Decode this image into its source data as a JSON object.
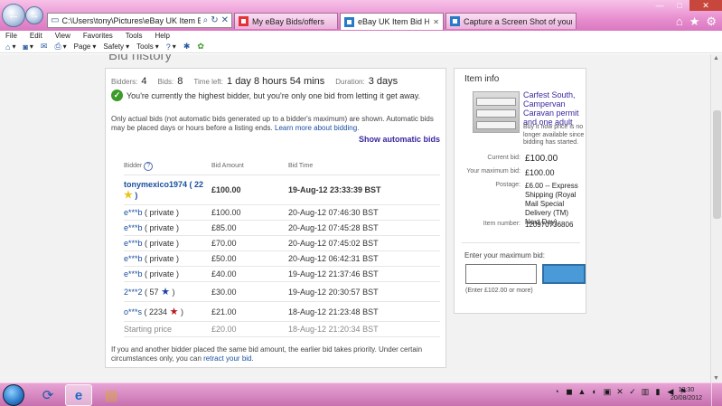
{
  "browser": {
    "address": "C:\\Users\\tony\\Pictures\\eBay UK Item Bid History 1.",
    "tabs": [
      {
        "label": "My eBay Bids/offers"
      },
      {
        "label": "eBay UK Item Bid History"
      },
      {
        "label": "Capture a Screen Shot of your ..."
      }
    ],
    "menu": [
      "File",
      "Edit",
      "View",
      "Favorites",
      "Tools",
      "Help"
    ],
    "commands": [
      "Page",
      "Safety",
      "Tools"
    ]
  },
  "page": {
    "heading": "Bid history",
    "stats": [
      {
        "label": "Bidders:",
        "value": "4"
      },
      {
        "label": "Bids:",
        "value": "8"
      },
      {
        "label": "Time left:",
        "value": "1 day 8 hours 54 mins"
      },
      {
        "label": "Duration:",
        "value": "3 days"
      }
    ],
    "highest_bidder_msg": "You're currently the highest bidder, but you're only one bid from letting it get away.",
    "note": "Only actual bids (not automatic bids generated up to a bidder's maximum) are shown. Automatic bids may be placed days or hours before a listing ends.",
    "note_link": "Learn more about bidding.",
    "show_automatic": "Show automatic bids",
    "table": {
      "headers": {
        "bidder": "Bidder",
        "amount": "Bid Amount",
        "time": "Bid Time"
      },
      "top": {
        "bidder": "tonymexico1974",
        "score": "22",
        "amount": "£100.00",
        "time": "19-Aug-12 23:33:39 BST"
      },
      "rows": [
        {
          "bidder": "e***b",
          "private": "( private )",
          "amount": "£100.00",
          "time": "20-Aug-12 07:46:30 BST"
        },
        {
          "bidder": "e***b",
          "private": "( private )",
          "amount": "£85.00",
          "time": "20-Aug-12 07:45:28 BST"
        },
        {
          "bidder": "e***b",
          "private": "( private )",
          "amount": "£70.00",
          "time": "20-Aug-12 07:45:02 BST"
        },
        {
          "bidder": "e***b",
          "private": "( private )",
          "amount": "£50.00",
          "time": "20-Aug-12 06:42:31 BST"
        },
        {
          "bidder": "e***b",
          "private": "( private )",
          "amount": "£40.00",
          "time": "19-Aug-12 21:37:46 BST"
        }
      ],
      "row_2": {
        "bidder": "2***2",
        "score": "57",
        "amount": "£30.00",
        "time": "19-Aug-12 20:30:57 BST"
      },
      "row_o": {
        "bidder": "o***s",
        "score": "2234",
        "amount": "£21.00",
        "time": "18-Aug-12 21:23:48 BST"
      },
      "start": {
        "label": "Starting price",
        "amount": "£20.00",
        "time": "18-Aug-12 21:20:34 BST"
      }
    },
    "footnote": "If you and another bidder placed the same bid amount, the earlier bid takes priority. Under certain circumstances only, you can",
    "footnote_link": "retract your bid."
  },
  "item_info": {
    "title": "Item info",
    "item_title": "Carfest South, Campervan Caravan permit and one adult",
    "bin_note": "Buy it now price is no longer available since bidding has started.",
    "current_bid_label": "Current bid:",
    "current_bid": "£100.00",
    "max_bid_label": "Your maximum bid:",
    "max_bid": "£100.00",
    "postage_label": "Postage:",
    "postage": "£6.00 -- Express Shipping (Royal Mail Special Delivery (TM) Next Day).",
    "item_number_label": "Item number:",
    "item_number": "120970736806",
    "enter_max_label": "Enter your maximum bid:",
    "enter_hint": "(Enter £102.00 or more)"
  },
  "taskbar": {
    "time": "12:30",
    "date": "20/08/2012"
  },
  "colors": {
    "link": "#1a4fa0",
    "accent_purple": "#3a2aa0",
    "chrome_pink": "#e88fd0"
  }
}
